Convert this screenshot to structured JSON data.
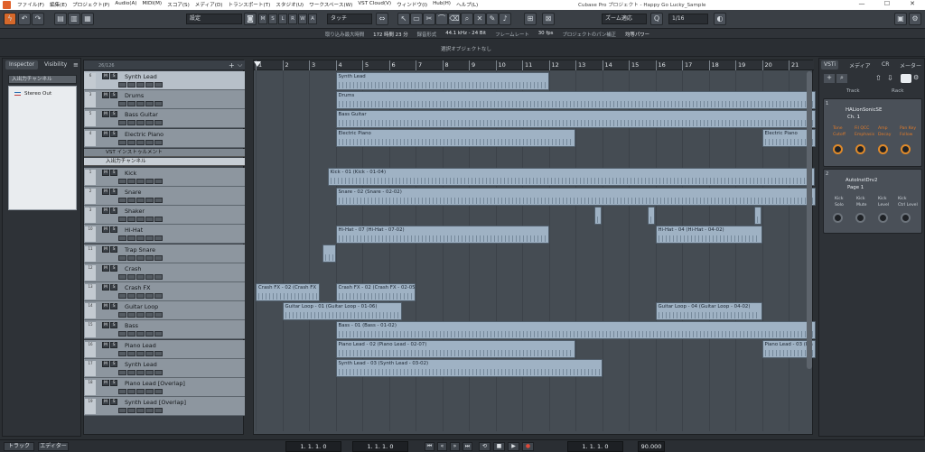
{
  "titlebar": {
    "menus": [
      "ファイル(F)",
      "編集(E)",
      "プロジェクト(P)",
      "Audio(A)",
      "MIDI(M)",
      "スコア(S)",
      "メディア(D)",
      "トランスポート(T)",
      "スタジオ(U)",
      "ワークスペース(W)",
      "VST Cloud(V)",
      "ウィンドウ(I)",
      "Hub(H)",
      "ヘルプ(L)"
    ],
    "title": "Cubase Pro プロジェクト - Happy Go Lucky_Sample",
    "min": "—",
    "max": "☐",
    "close": "✕"
  },
  "toolbar": {
    "preset_label": "設定",
    "mode_label": "タッチ",
    "groups": [
      "M",
      "S",
      "L",
      "R",
      "W",
      "A"
    ],
    "grid_label": "ズーム適応",
    "quantize": "1/16"
  },
  "status": {
    "rec_time_label": "取り込み最大時間",
    "rec_time": "172 時間 23 分",
    "format_label": "録音形式",
    "format": "44.1 kHz - 24 Bit",
    "fps_label": "フレームレート",
    "fps": "30 fps",
    "pan_label": "プロジェクトのパン補正",
    "pan": "均等パワー"
  },
  "infoline": {
    "text": "選択オブジェクトなし"
  },
  "inspector": {
    "tab_inspector": "Inspector",
    "tab_visibility": "Visibility",
    "selector": "入出力チャンネル",
    "output": "Stereo Out"
  },
  "tracklist": {
    "count": "26/126",
    "folder_vst": "VST インストゥルメント",
    "folder_io": "入出力チャンネル",
    "tracks": [
      {
        "num": "6",
        "name": "Synth Lead",
        "ch": "1"
      },
      {
        "num": "3",
        "name": "Drums",
        "ch": "1"
      },
      {
        "num": "5",
        "name": "Bass Guitar",
        "ch": "1"
      },
      {
        "num": "4",
        "name": "Electric Piano",
        "ch": "2"
      }
    ],
    "audio": [
      {
        "num": "1",
        "name": "Kick"
      },
      {
        "num": "2",
        "name": "Snare"
      },
      {
        "num": "3",
        "name": "Shaker"
      },
      {
        "num": "10",
        "name": "Hi-Hat"
      },
      {
        "num": "11",
        "name": "Trap Snare"
      },
      {
        "num": "12",
        "name": "Crash"
      },
      {
        "num": "13",
        "name": "Crash FX"
      },
      {
        "num": "14",
        "name": "Guitar Loop"
      },
      {
        "num": "15",
        "name": "Bass"
      },
      {
        "num": "16",
        "name": "Piano Lead"
      },
      {
        "num": "17",
        "name": "Synth Lead"
      },
      {
        "num": "18",
        "name": "Piano Lead [Overlap]"
      },
      {
        "num": "19",
        "name": "Synth Lead [Overlap]"
      }
    ]
  },
  "ruler": [
    "1",
    "2",
    "3",
    "4",
    "5",
    "6",
    "7",
    "8",
    "9",
    "10",
    "11",
    "12",
    "13",
    "14",
    "15",
    "16",
    "17",
    "18",
    "19",
    "20",
    "21"
  ],
  "parts": [
    {
      "lane": 0,
      "bar": 4,
      "len": 8,
      "label": "Synth Lead"
    },
    {
      "lane": 1,
      "bar": 4,
      "len": 18,
      "label": "Drums"
    },
    {
      "lane": 2,
      "bar": 4,
      "len": 18,
      "label": "Bass Guitar"
    },
    {
      "lane": 3,
      "bar": 4,
      "len": 9,
      "label": "Electric Piano"
    },
    {
      "lane": 3,
      "bar": 20,
      "len": 2,
      "label": "Electric Piano"
    },
    {
      "lane": 6,
      "bar": 3.7,
      "len": 18.3,
      "label": "Kick - 01 (Kick - 01-04)"
    },
    {
      "lane": 7,
      "bar": 4,
      "len": 18,
      "label": "Snare - 02 (Snare - 02-02)"
    },
    {
      "lane": 8,
      "bar": 13.7,
      "len": 0.3,
      "label": ""
    },
    {
      "lane": 8,
      "bar": 15.7,
      "len": 0.3,
      "label": ""
    },
    {
      "lane": 8,
      "bar": 19.7,
      "len": 0.3,
      "label": ""
    },
    {
      "lane": 9,
      "bar": 4,
      "len": 8,
      "label": "Hi-Hat - 07 (Hi-Hat - 07-02)"
    },
    {
      "lane": 9,
      "bar": 16,
      "len": 4,
      "label": "Hi-Hat - 04 (Hi-Hat - 04-02)"
    },
    {
      "lane": 10,
      "bar": 3.5,
      "len": 0.5,
      "label": ""
    },
    {
      "lane": 12,
      "bar": 1,
      "len": 2.4,
      "label": "Crash FX - 02 (Crash FX"
    },
    {
      "lane": 12,
      "bar": 4,
      "len": 3,
      "label": "Crash FX - 02 (Crash FX - 02-05)"
    },
    {
      "lane": 13,
      "bar": 2,
      "len": 4.5,
      "label": "Guitar Loop - 01 (Guitar Loop - 01-06)"
    },
    {
      "lane": 13,
      "bar": 16,
      "len": 4,
      "label": "Guitar Loop - 04 (Guitar Loop - 04-02)"
    },
    {
      "lane": 14,
      "bar": 4,
      "len": 18,
      "label": "Bass - 01 (Bass - 01-02)"
    },
    {
      "lane": 15,
      "bar": 4,
      "len": 9,
      "label": "Piano Lead - 02 (Piano Lead - 02-07)"
    },
    {
      "lane": 15,
      "bar": 20,
      "len": 2,
      "label": "Piano Lead - 03 (Pia"
    },
    {
      "lane": 16,
      "bar": 4,
      "len": 10,
      "label": "Synth Lead - 03 (Synth Lead - 03-02)"
    }
  ],
  "vst": {
    "tab_vsti": "VSTi",
    "tab_media": "メディア",
    "tab_cr": "CR",
    "tab_meter": "メーター",
    "track": "Track",
    "rack": "Rack",
    "slot1": {
      "n": "1",
      "name": "HALionSonicSE",
      "sub": "Ch. 1",
      "l1": [
        "Tone",
        "Cutoff"
      ],
      "l2": [
        "Fil QCC",
        "Emphasis"
      ],
      "l3": [
        "Amp",
        "Decay"
      ],
      "l4": [
        "Pan Key",
        "Follow"
      ]
    },
    "slot2": {
      "n": "2",
      "name": "AutoInstDrv2",
      "sub": "Page 1",
      "l1": [
        "Kick",
        "Solo"
      ],
      "l2": [
        "Kick",
        "Mute"
      ],
      "l3": [
        "Kick",
        "Level"
      ],
      "l4": [
        "Kick",
        "Ctrl Level"
      ]
    }
  },
  "bottom": {
    "tab_track": "トラック",
    "tab_editor": "エディター",
    "pos1": "1. 1. 1. 0",
    "pos2": "1. 1. 1. 0",
    "pos3": "1. 1. 1. 0",
    "tempo": "90.000"
  }
}
